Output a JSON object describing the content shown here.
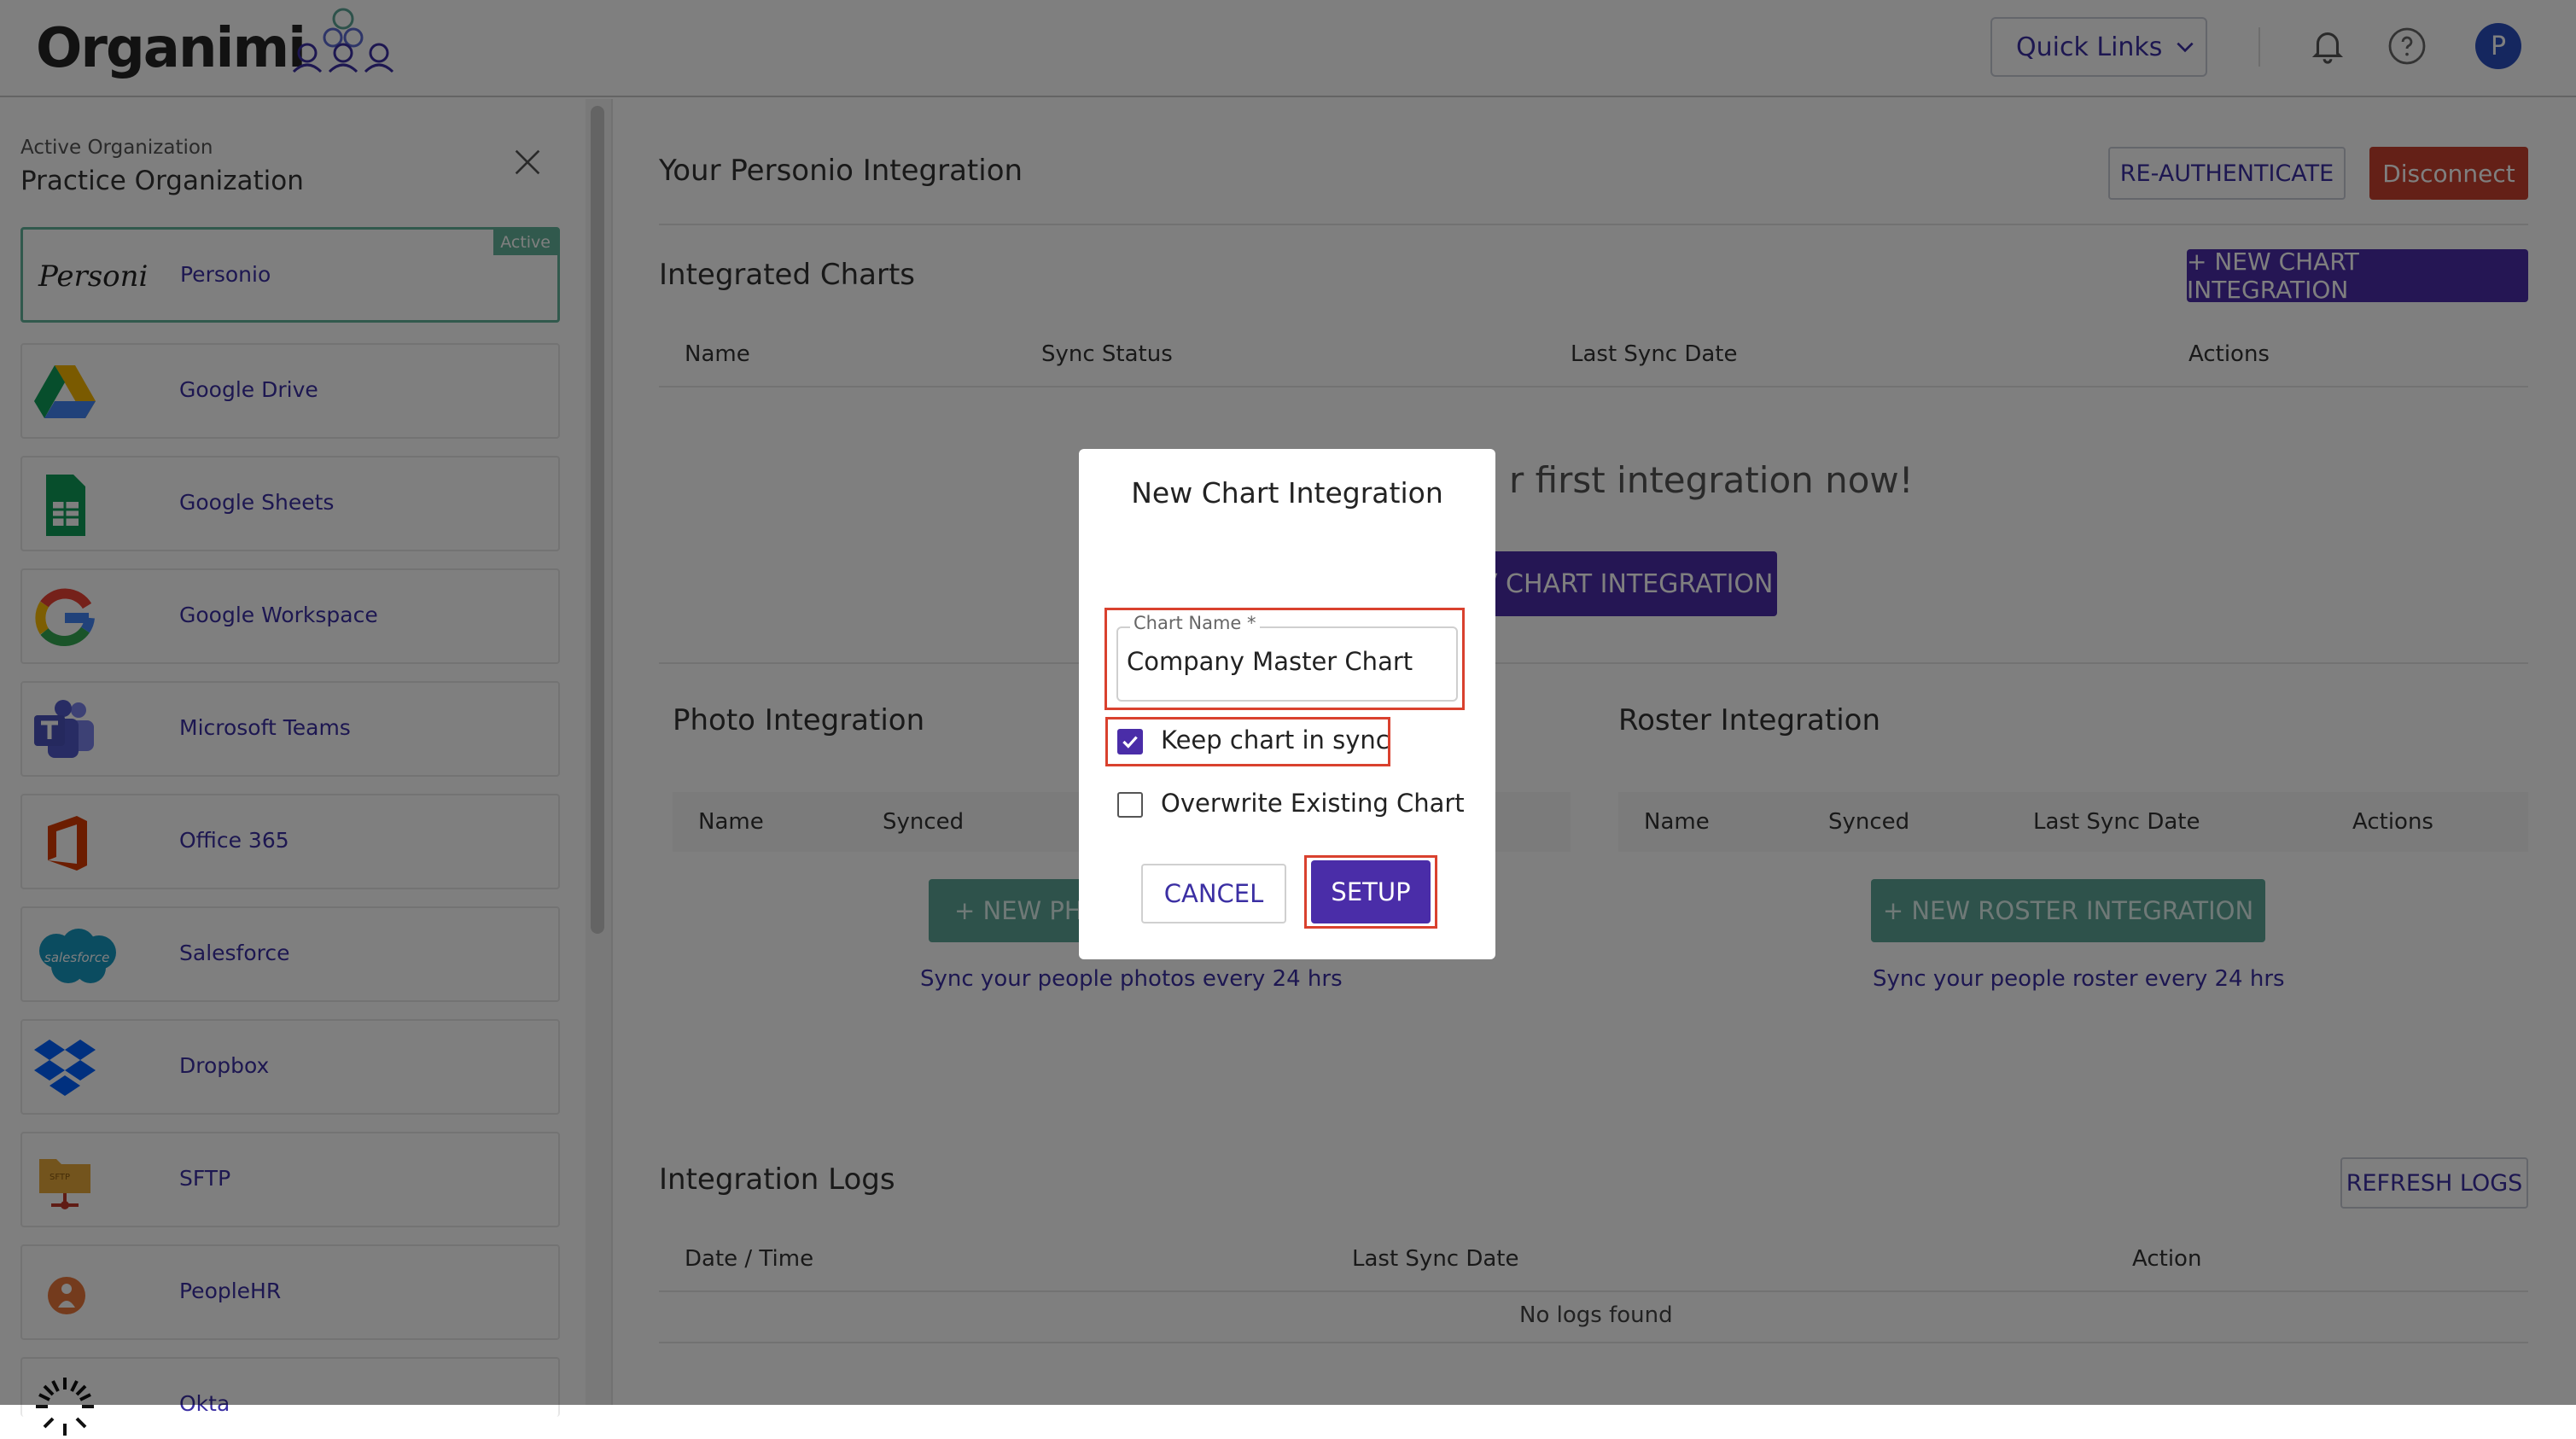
{
  "app": {
    "name": "Organimi"
  },
  "topbar": {
    "quick_links_label": "Quick Links",
    "avatar_initial": "P"
  },
  "sidebar": {
    "org_label": "Active Organization",
    "org_name": "Practice Organization",
    "active_badge": "Active",
    "items": [
      {
        "label": "Personio",
        "icon": "personio-logo",
        "active": true
      },
      {
        "label": "Google Drive",
        "icon": "google-drive-icon"
      },
      {
        "label": "Google Sheets",
        "icon": "google-sheets-icon"
      },
      {
        "label": "Google Workspace",
        "icon": "google-icon"
      },
      {
        "label": "Microsoft Teams",
        "icon": "microsoft-teams-icon"
      },
      {
        "label": "Office 365",
        "icon": "office-365-icon"
      },
      {
        "label": "Salesforce",
        "icon": "salesforce-icon"
      },
      {
        "label": "Dropbox",
        "icon": "dropbox-icon"
      },
      {
        "label": "SFTP",
        "icon": "sftp-icon"
      },
      {
        "label": "PeopleHR",
        "icon": "peoplehr-icon"
      },
      {
        "label": "Okta",
        "icon": "okta-icon"
      }
    ]
  },
  "main": {
    "integration_title": "Your Personio Integration",
    "reauth_label": "RE-AUTHENTICATE",
    "disconnect_label": "Disconnect",
    "charts_title": "Integrated Charts",
    "new_chart_label": "+ NEW CHART INTEGRATION",
    "charts_columns": [
      "Name",
      "Sync Status",
      "Last Sync Date",
      "Actions"
    ],
    "empty_text": "r first integration now!",
    "empty_cta": "V CHART INTEGRATION",
    "photo_title": "Photo Integration",
    "photo_columns": [
      "Name",
      "Synced"
    ],
    "photo_btn": "+ NEW PHO",
    "photo_sync_text": "Sync your people photos every 24 hrs",
    "roster_title": "Roster Integration",
    "roster_columns": [
      "Name",
      "Synced",
      "Last Sync Date",
      "Actions"
    ],
    "roster_btn": "+ NEW ROSTER INTEGRATION",
    "roster_sync_text": "Sync your people roster every 24 hrs",
    "logs_title": "Integration Logs",
    "refresh_label": "REFRESH LOGS",
    "logs_columns": [
      "Date / Time",
      "Last Sync Date",
      "Action"
    ],
    "no_logs": "No logs found"
  },
  "modal": {
    "title": "New Chart Integration",
    "field_label": "Chart Name *",
    "field_value": "Company Master Chart",
    "keep_sync_label": "Keep chart in sync",
    "keep_sync_checked": true,
    "overwrite_label": "Overwrite Existing Chart",
    "overwrite_checked": false,
    "cancel_label": "CANCEL",
    "setup_label": "SETUP"
  },
  "colors": {
    "accent": "#4a2da8",
    "highlight": "#d9412e",
    "teal": "#5ca596",
    "danger": "#c9412e"
  }
}
